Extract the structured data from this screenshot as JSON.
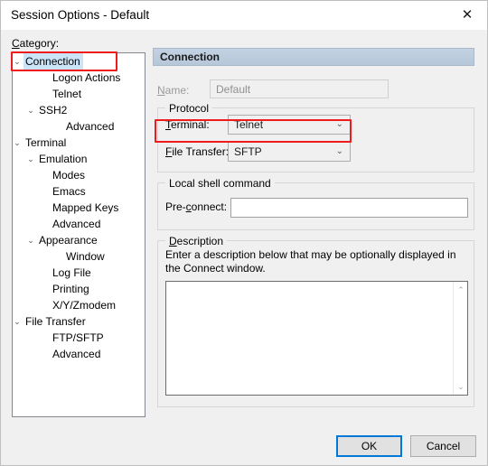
{
  "window": {
    "title": "Session Options - Default",
    "close_icon": "close-icon",
    "close_glyph": "✕"
  },
  "category": {
    "label_prefix": "C",
    "label_rest": "ategory:",
    "tree": [
      {
        "label": "Connection",
        "indent": 0,
        "chevron": "⌄",
        "selected": true
      },
      {
        "label": "Logon Actions",
        "indent": 2,
        "chevron": "",
        "selected": false
      },
      {
        "label": "Telnet",
        "indent": 2,
        "chevron": "",
        "selected": false
      },
      {
        "label": "SSH2",
        "indent": 1,
        "chevron": "⌄",
        "selected": false
      },
      {
        "label": "Advanced",
        "indent": 3,
        "chevron": "",
        "selected": false
      },
      {
        "label": "Terminal",
        "indent": 0,
        "chevron": "⌄",
        "selected": false
      },
      {
        "label": "Emulation",
        "indent": 1,
        "chevron": "⌄",
        "selected": false
      },
      {
        "label": "Modes",
        "indent": 2,
        "chevron": "",
        "selected": false
      },
      {
        "label": "Emacs",
        "indent": 2,
        "chevron": "",
        "selected": false
      },
      {
        "label": "Mapped Keys",
        "indent": 2,
        "chevron": "",
        "selected": false
      },
      {
        "label": "Advanced",
        "indent": 2,
        "chevron": "",
        "selected": false
      },
      {
        "label": "Appearance",
        "indent": 1,
        "chevron": "⌄",
        "selected": false
      },
      {
        "label": "Window",
        "indent": 3,
        "chevron": "",
        "selected": false
      },
      {
        "label": "Log File",
        "indent": 2,
        "chevron": "",
        "selected": false
      },
      {
        "label": "Printing",
        "indent": 2,
        "chevron": "",
        "selected": false
      },
      {
        "label": "X/Y/Zmodem",
        "indent": 2,
        "chevron": "",
        "selected": false
      },
      {
        "label": "File Transfer",
        "indent": 0,
        "chevron": "⌄",
        "selected": false
      },
      {
        "label": "FTP/SFTP",
        "indent": 2,
        "chevron": "",
        "selected": false
      },
      {
        "label": "Advanced",
        "indent": 2,
        "chevron": "",
        "selected": false
      }
    ]
  },
  "pane": {
    "header": "Connection",
    "name_label_prefix": "N",
    "name_label_rest": "ame:",
    "name_value": "Default",
    "protocol": {
      "title": "Protocol",
      "terminal_label_prefix": "T",
      "terminal_label_rest": "erminal:",
      "terminal_value": "Telnet",
      "file_transfer_label_prefix": "F",
      "file_transfer_label_rest": "ile Transfer:",
      "file_transfer_value": "SFTP",
      "dropdown_arrow": "⌄"
    },
    "local_shell": {
      "title": "Local shell command",
      "preconnect_label_pre": "Pre-",
      "preconnect_label_accel": "c",
      "preconnect_label_rest": "onnect:",
      "preconnect_value": "",
      "preconnect_placeholder": ""
    },
    "description": {
      "title_prefix": "D",
      "title_rest": "escription",
      "help_text": "Enter a description below that may be optionally displayed in the Connect window.",
      "value": "",
      "scroll_up_icon": "chevron-up-icon",
      "scroll_down_icon": "chevron-down-icon",
      "scroll_up_glyph": "⌃",
      "scroll_down_glyph": "⌄"
    }
  },
  "footer": {
    "ok_label": "OK",
    "cancel_label": "Cancel"
  },
  "colors": {
    "accent": "#0078d7",
    "annotation": "#ee1c1c",
    "header_bg": "#b6c7da",
    "selection": "#cce4f7"
  }
}
